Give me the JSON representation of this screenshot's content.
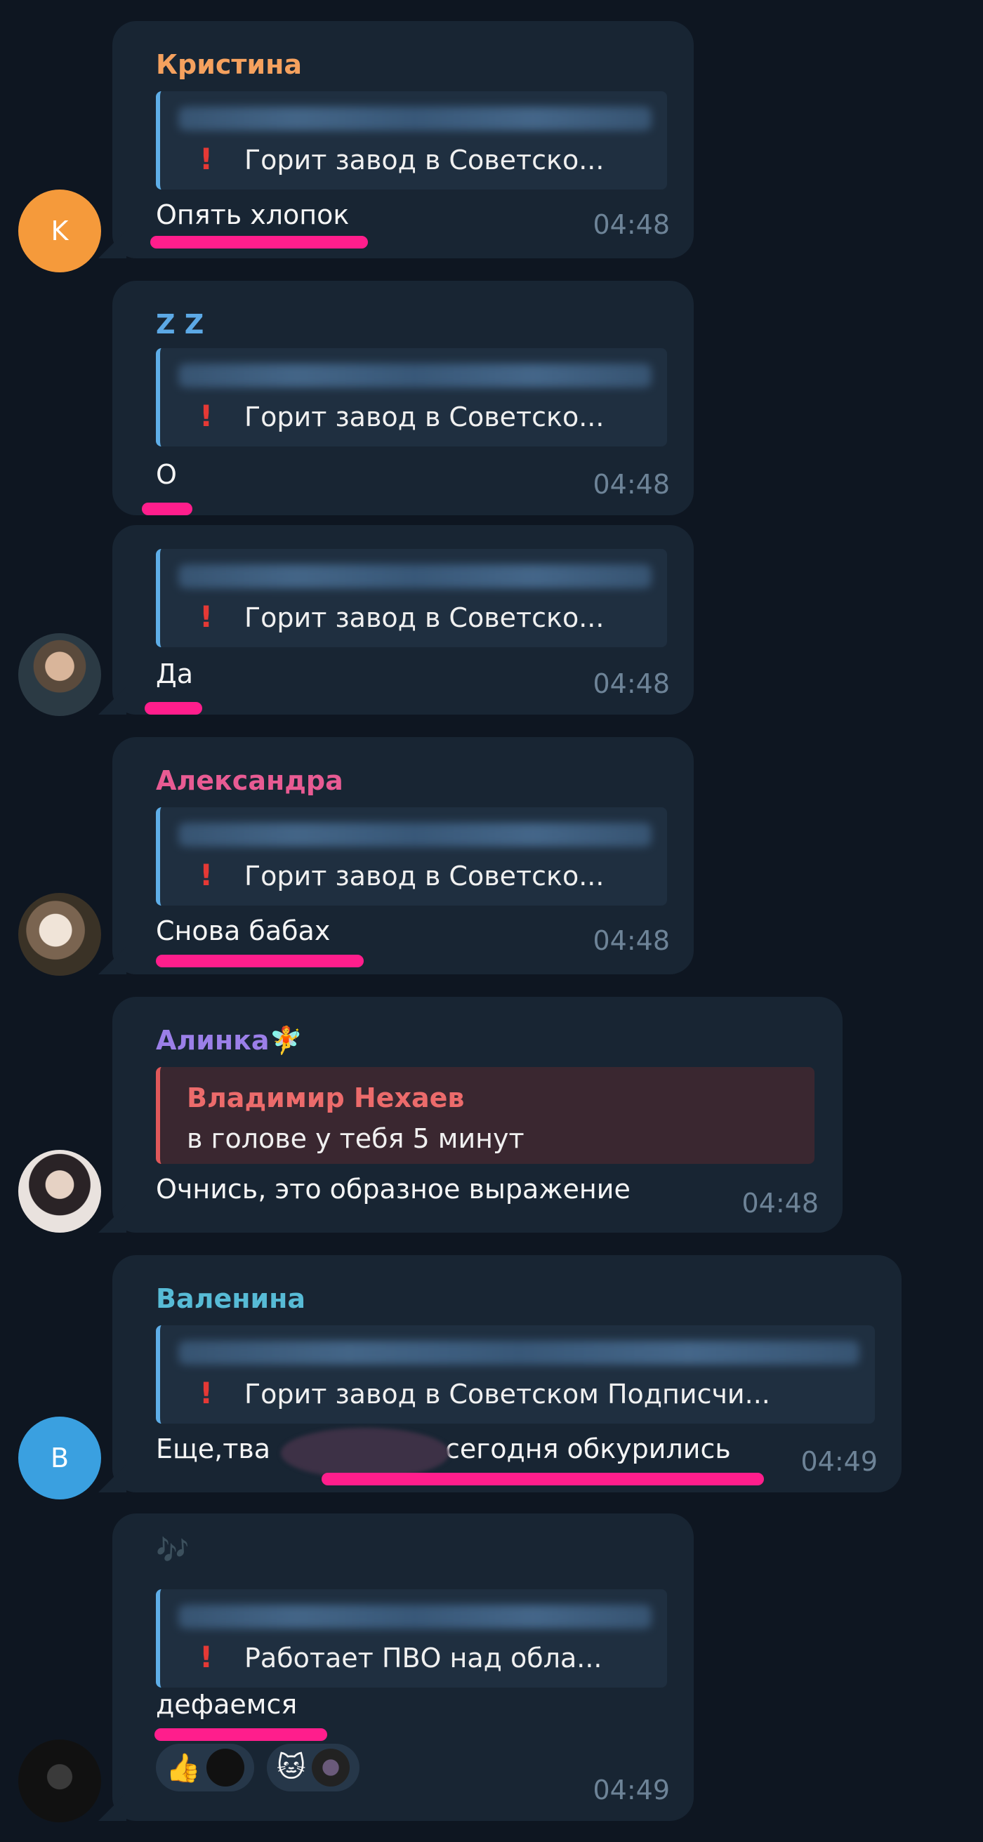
{
  "messages": [
    {
      "sender": "Кристина",
      "sender_color": "#f5a15e",
      "avatar_letter": "K",
      "avatar_color": "#f59a3b",
      "reply": "Горит завод в Советско...",
      "text": "Опять хлопок",
      "time": "04:48"
    },
    {
      "sender": "Z Z",
      "sender_color": "#5ca9e6",
      "reply": "Горит завод в Советско...",
      "text": "О",
      "time": "04:48"
    },
    {
      "reply": "Горит завод в Советско...",
      "text": "Да",
      "time": "04:48"
    },
    {
      "sender": "Александра",
      "sender_color": "#e85b93",
      "reply": "Горит завод в Советско...",
      "text": "Снова бабах",
      "time": "04:48"
    },
    {
      "sender": "Алинка",
      "sender_color": "#9b7fe8",
      "sender_emoji": "🧚",
      "quote_name": "Владимир Нехаев",
      "quote_text": "в голове у тебя 5 минут",
      "text": "Очнись, это образное выражение",
      "time": "04:48"
    },
    {
      "sender": "Валенина",
      "sender_color": "#57bbd6",
      "avatar_letter": "B",
      "avatar_color": "#3aa0e0",
      "reply": "Горит завод в Советском  Подписчи...",
      "text_left": "Еще,тва",
      "text_right": "сегодня обкурились",
      "time": "04:49"
    },
    {
      "sender_emoji": "🎶",
      "reply": "Работает ПВО над обла...",
      "text": "дефаемся",
      "reactions": [
        "👍",
        "🐱"
      ],
      "time": "04:49"
    }
  ]
}
